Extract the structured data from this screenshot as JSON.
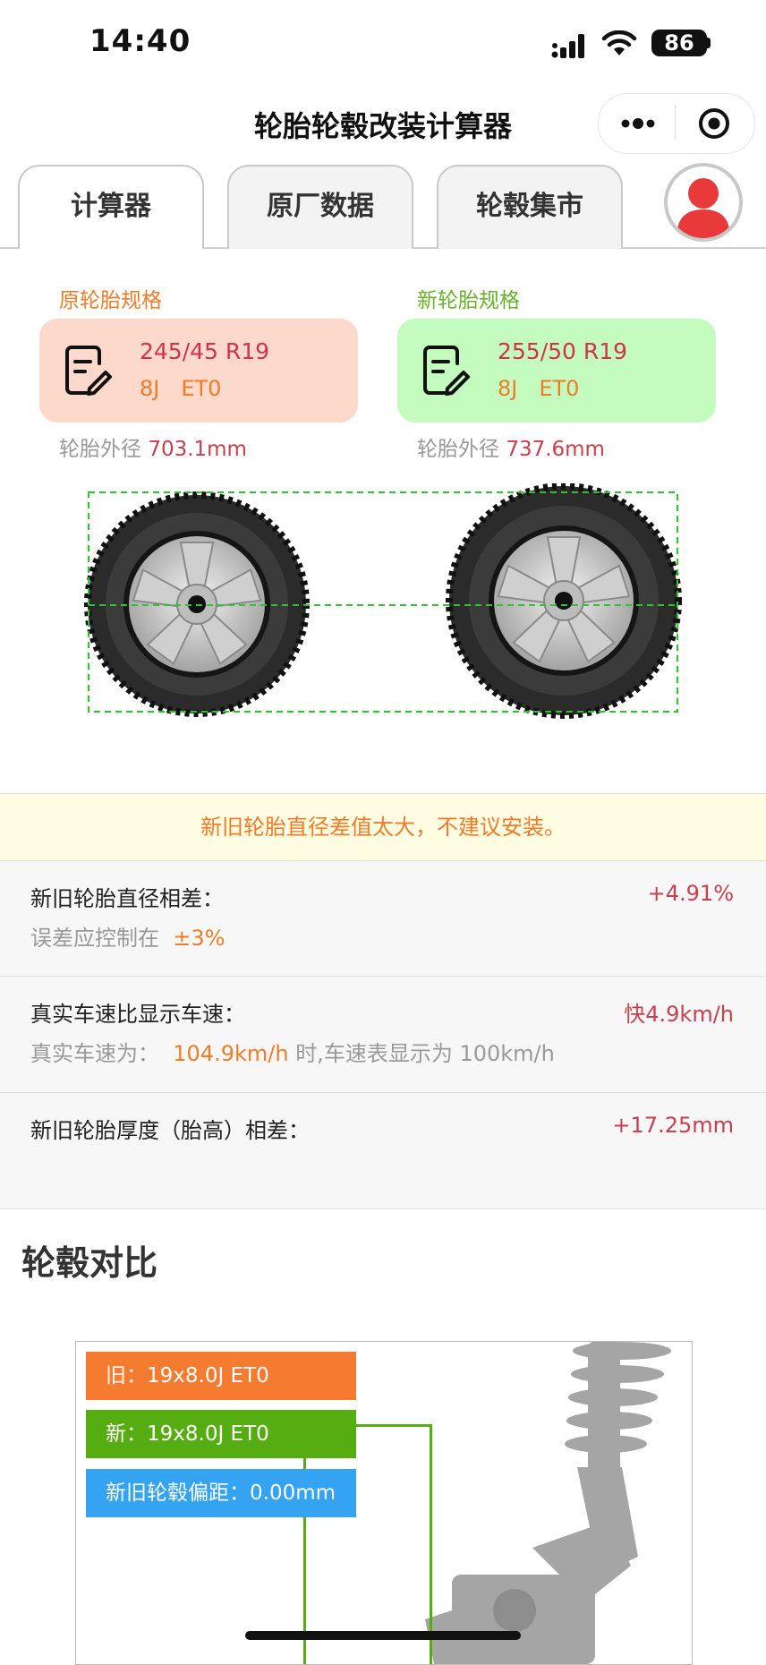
{
  "status_bar": {
    "time": "14:40",
    "battery": "86"
  },
  "nav": {
    "title": "轮胎轮毂改装计算器"
  },
  "tabs": [
    {
      "label": "计算器",
      "active": true
    },
    {
      "label": "原厂数据",
      "active": false
    },
    {
      "label": "轮毂集市",
      "active": false
    }
  ],
  "original": {
    "label": "原轮胎规格",
    "size": "245/45 R19",
    "rim": "8J　ET0",
    "outer_label": "轮胎外径",
    "outer_value": "703.1mm",
    "label_color": "#f07c2a",
    "card_color": "#fdd9cc"
  },
  "new": {
    "label": "新轮胎规格",
    "size": "255/50 R19",
    "rim": "8J　ET0",
    "outer_label": "轮胎外径",
    "outer_value": "737.6mm",
    "label_color": "#6ab02c",
    "card_color": "#c3fcbe"
  },
  "warning": "新旧轮胎直径差值太大，不建议安装。",
  "diameter": {
    "label": "新旧轮胎直径相差：",
    "value": "+4.91%",
    "sub_label": "误差应控制在",
    "sub_value": "±3%"
  },
  "speed": {
    "label": "真实车速比显示车速：",
    "value": "快4.9km/h",
    "sub_label": "真实车速为：",
    "sub_value": "104.9km/h",
    "sub_suffix": "时,车速表显示为 100km/h"
  },
  "thickness": {
    "label": "新旧轮胎厚度（胎高）相差：",
    "value": "+17.25mm"
  },
  "wheel_compare": {
    "title": "轮毂对比",
    "old_label": "旧：19x8.0J ET0",
    "new_label": "新：19x8.0J ET0",
    "offset_label": "新旧轮毂偏距：0.00mm",
    "old_color": "#f57b30",
    "new_color": "#56ad12",
    "offset_color": "#33a3f2"
  }
}
